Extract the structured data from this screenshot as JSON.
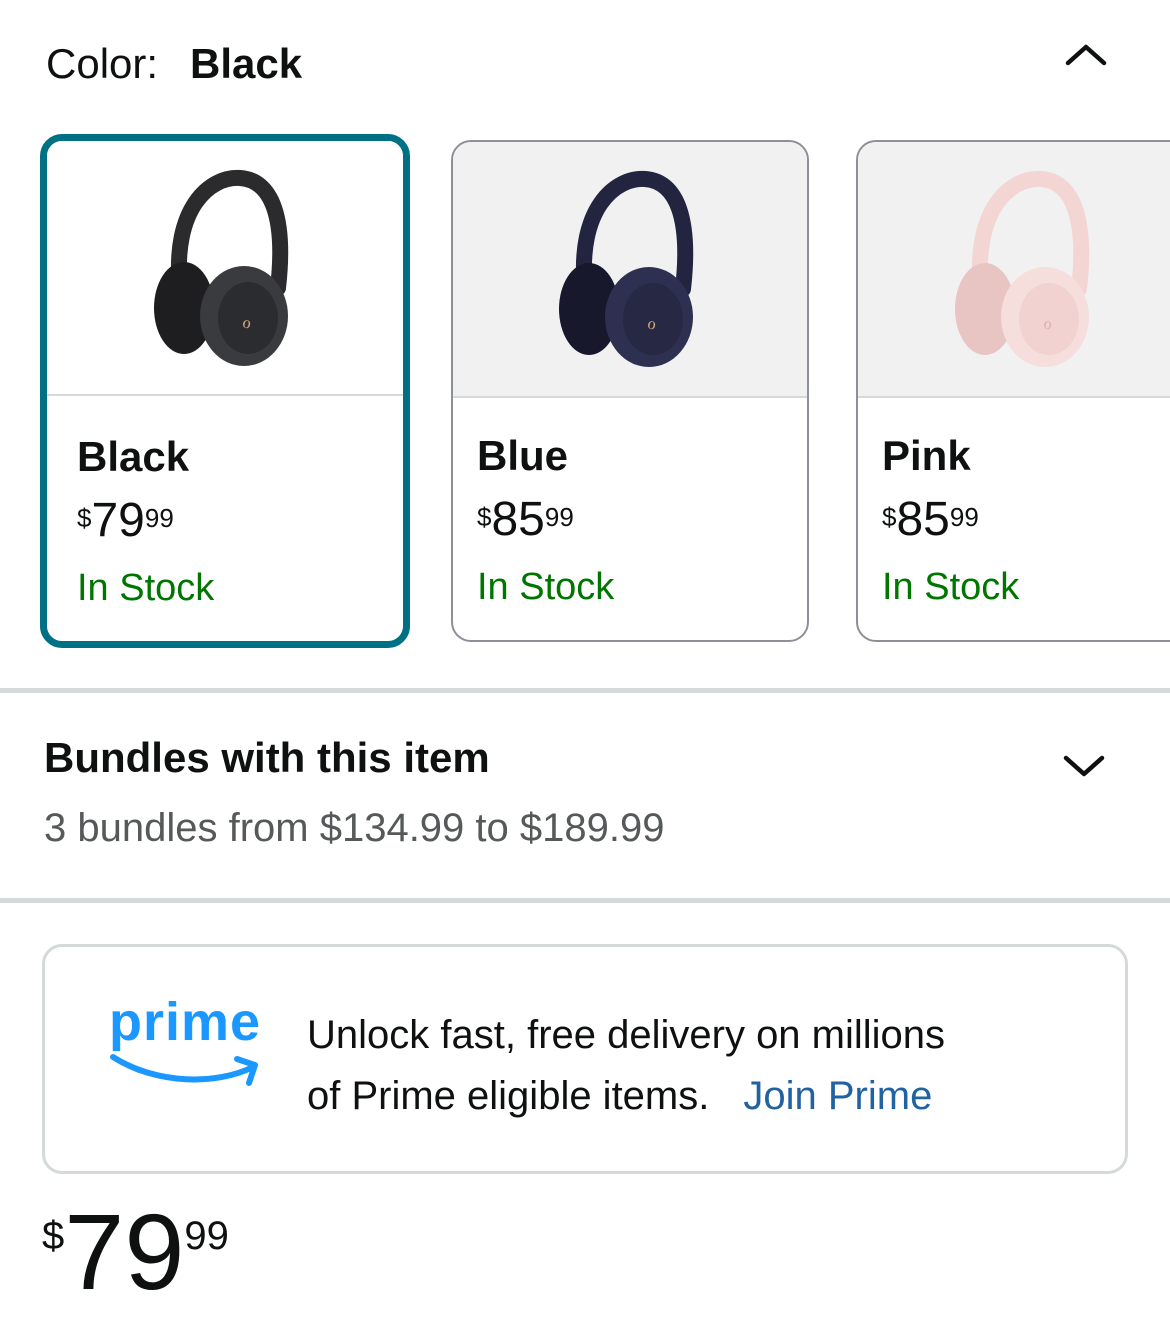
{
  "color_selector": {
    "label": "Color:",
    "selected_value": "Black",
    "collapse_icon": "chevron-up-icon"
  },
  "swatches": [
    {
      "name": "Black",
      "price_symbol": "$",
      "price_whole": "79",
      "price_fraction": "99",
      "stock": "In Stock",
      "color": "#2b2b2d",
      "selected": true
    },
    {
      "name": "Blue",
      "price_symbol": "$",
      "price_whole": "85",
      "price_fraction": "99",
      "stock": "In Stock",
      "color": "#23243f",
      "selected": false
    },
    {
      "name": "Pink",
      "price_symbol": "$",
      "price_whole": "85",
      "price_fraction": "99",
      "stock": "In Stock",
      "color": "#f3d6d4",
      "selected": false
    }
  ],
  "bundles": {
    "title": "Bundles with this item",
    "subtitle": "3 bundles from $134.99 to $189.99",
    "expand_icon": "chevron-down-icon"
  },
  "prime": {
    "logo_text": "prime",
    "message_line1": "Unlock fast, free delivery on millions",
    "message_line2": "of Prime eligible items.",
    "join_link": "Join Prime",
    "brand_color": "#1a98ff",
    "link_color": "#2162a1"
  },
  "price": {
    "symbol": "$",
    "whole": "79",
    "fraction": "99"
  },
  "colors": {
    "selected_border": "#007185",
    "in_stock": "#007600"
  }
}
